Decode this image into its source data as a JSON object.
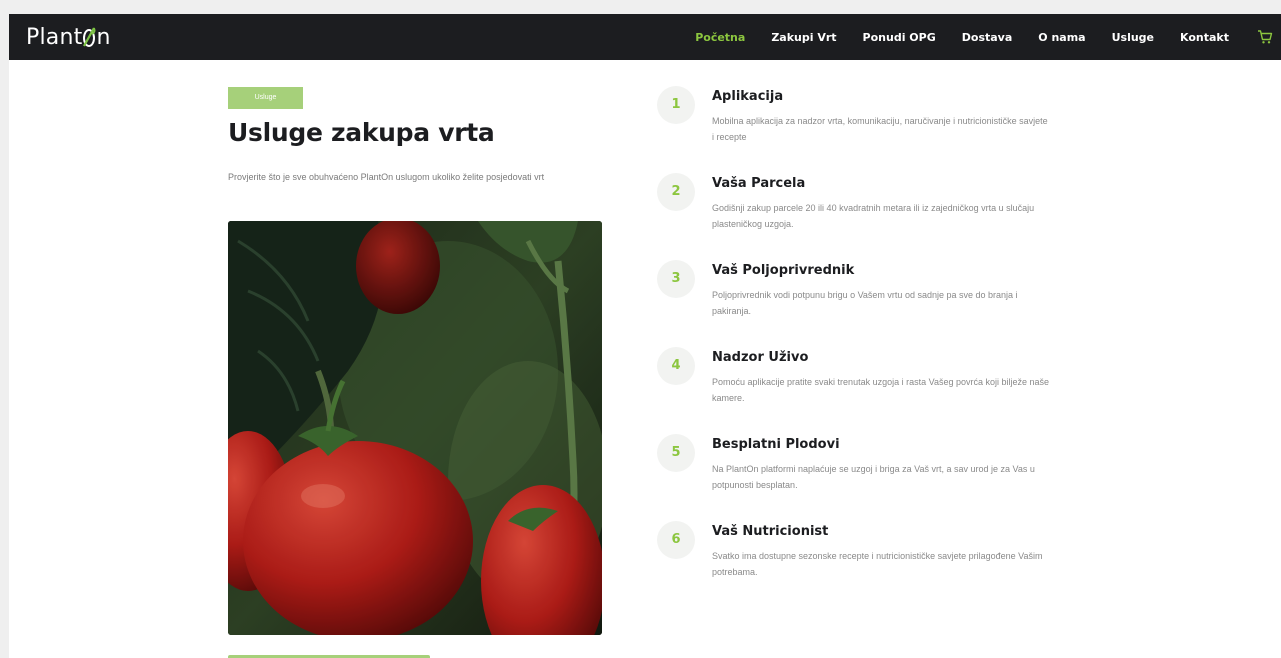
{
  "nav": {
    "logo_left": "Plant",
    "logo_right": "n",
    "links": [
      "Početna",
      "Zakupi Vrt",
      "Ponudi OPG",
      "Dostava",
      "O nama",
      "Usluge",
      "Kontakt"
    ],
    "active_index": 0
  },
  "colors": {
    "accent": "#8cc63f",
    "nav_bg": "#1c1d20",
    "badge_bg": "#a6d07a"
  },
  "hero": {
    "badge": "Usluge",
    "title": "Usluge zakupa vrta",
    "subtitle": "Provjerite što je sve obuhvaćeno PlantOn uslugom ukoliko želite posjedovati vrt"
  },
  "features": [
    {
      "num": "1",
      "title": "Aplikacija",
      "text": "Mobilna aplikacija za nadzor vrta, komunikaciju, naručivanje i nutricionističke savjete i recepte"
    },
    {
      "num": "2",
      "title": "Vaša Parcela",
      "text": "Godišnji zakup parcele 20 ili 40 kvadratnih metara ili iz zajedničkog vrta u slučaju plasteničkog uzgoja."
    },
    {
      "num": "3",
      "title": "Vaš Poljoprivrednik",
      "text": "Poljoprivrednik vodi potpunu brigu o Vašem vrtu od sadnje pa sve do branja i pakiranja."
    },
    {
      "num": "4",
      "title": "Nadzor Uživo",
      "text": "Pomoću aplikacije pratite svaki trenutak uzgoja i rasta Vašeg povrća koji bilježe naše kamere."
    },
    {
      "num": "5",
      "title": "Besplatni Plodovi",
      "text": "Na PlantOn platformi naplaćuje se uzgoj i briga za Vaš vrt, a sav urod je za Vas u potpunosti besplatan."
    },
    {
      "num": "6",
      "title": "Vaš Nutricionist",
      "text": "Svatko ima dostupne sezonske recepte i nutricionističke savjete prilagođene Vašim potrebama."
    }
  ]
}
